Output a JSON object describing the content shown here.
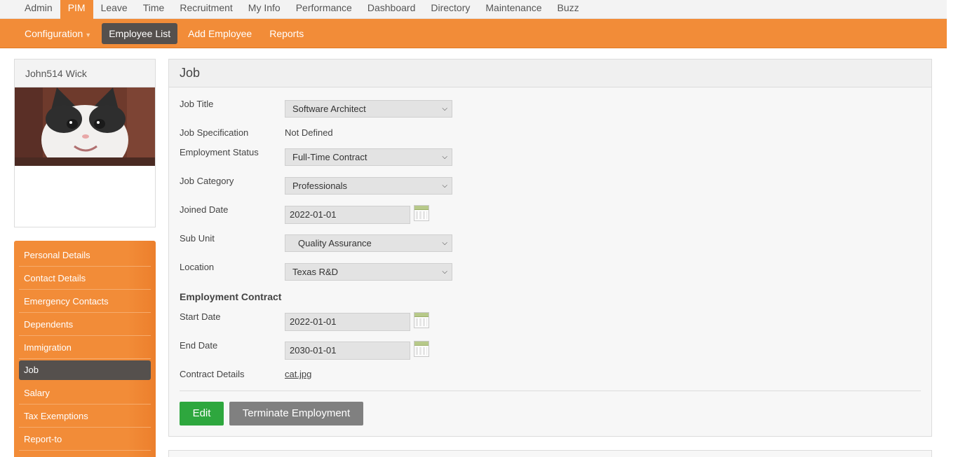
{
  "topnav": [
    "Admin",
    "PIM",
    "Leave",
    "Time",
    "Recruitment",
    "My Info",
    "Performance",
    "Dashboard",
    "Directory",
    "Maintenance",
    "Buzz"
  ],
  "subnav": {
    "configuration": "Configuration",
    "employee_list": "Employee List",
    "add_employee": "Add Employee",
    "reports": "Reports"
  },
  "profile": {
    "name": "John514 Wick"
  },
  "sidemenu": [
    "Personal Details",
    "Contact Details",
    "Emergency Contacts",
    "Dependents",
    "Immigration",
    "Job",
    "Salary",
    "Tax Exemptions",
    "Report-to"
  ],
  "job": {
    "title": "Job",
    "job_title_label": "Job Title",
    "job_title_value": "Software Architect",
    "job_spec_label": "Job Specification",
    "job_spec_value": "Not Defined",
    "emp_status_label": "Employment Status",
    "emp_status_value": "Full-Time Contract",
    "job_category_label": "Job Category",
    "job_category_value": "Professionals",
    "joined_date_label": "Joined Date",
    "joined_date_value": "2022-01-01",
    "sub_unit_label": "Sub Unit",
    "sub_unit_value": "Quality Assurance",
    "location_label": "Location",
    "location_value": "Texas R&D",
    "contract_section": "Employment Contract",
    "start_date_label": "Start Date",
    "start_date_value": "2022-01-01",
    "end_date_label": "End Date",
    "end_date_value": "2030-01-01",
    "contract_details_label": "Contract Details",
    "contract_details_value": "cat.jpg",
    "edit_label": "Edit",
    "terminate_label": "Terminate Employment"
  },
  "colors": {
    "accent": "#f28c38",
    "active": "#55504d",
    "edit": "#2ea73e",
    "terminate": "#808080"
  }
}
